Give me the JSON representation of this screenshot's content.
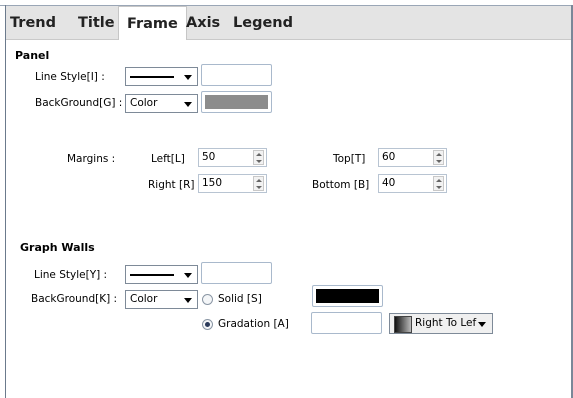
{
  "tabs": [
    {
      "label": "Trend",
      "active": false
    },
    {
      "label": "Title",
      "active": false
    },
    {
      "label": "Frame",
      "active": true
    },
    {
      "label": "Axis",
      "active": false
    },
    {
      "label": "Legend",
      "active": false
    }
  ],
  "panel": {
    "title": "Panel",
    "line_style_label": "Line Style[I] :",
    "background_label": "BackGround[G] :",
    "background_value": "Color",
    "line_color": "#ffffff",
    "background_color": "#8c8c8c",
    "margins_label": "Margins :",
    "left_label": "Left[L]",
    "left_value": "50",
    "top_label": "Top[T]",
    "top_value": "60",
    "right_label": "Right [R]",
    "right_value": "150",
    "bottom_label": "Bottom [B]",
    "bottom_value": "40"
  },
  "graph_walls": {
    "title": "Graph Walls",
    "line_style_label": "Line Style[Y] :",
    "background_label": "BackGround[K] :",
    "background_value": "Color",
    "line_color": "#ffffff",
    "solid_label": "Solid [S]",
    "solid_selected": false,
    "solid_color": "#000000",
    "gradation_label": "Gradation [A]",
    "gradation_selected": true,
    "gradation_color": "#ffffff",
    "direction_value": "Right To Lef"
  }
}
